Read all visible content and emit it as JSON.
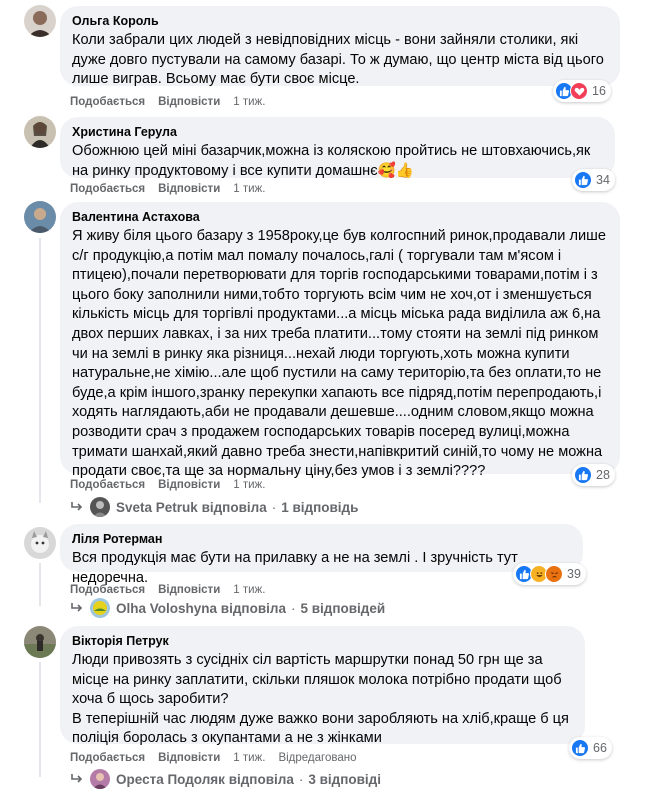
{
  "comments": [
    {
      "author": "Ольга Король",
      "text": "Коли забрали цих людей з невідповідних місць - вони зайняли столики, які дуже довго пустували на самому базарі. То ж думаю, що центр міста від цього лише виграв. Всьому має бути своє місце.",
      "like": "Подобається",
      "reply": "Відповісти",
      "time": "1 тиж.",
      "reaction_count": "16",
      "reactions": [
        "like-icon",
        "love-icon"
      ]
    },
    {
      "author": "Христина Герула",
      "text": "Обожнюю цей міні базарчик,можна із коляскою пройтись не штовхаючись,як на ринку продуктовому і все купити домашнє🥰👍",
      "like": "Подобається",
      "reply": "Відповісти",
      "time": "1 тиж.",
      "reaction_count": "34",
      "reactions": [
        "like-icon"
      ]
    },
    {
      "author": "Валентина Астахова",
      "text": "Я живу біля цього базару з 1958року,це був колгоспний ринок,продавали лише с/г продукцію,а потім мал помалу почалось,галі ( торгували там м'ясом і птицею),почали перетворювати для торгів господарськими товарами,потім і з цього боку заполнили ними,тобто торгують всім чим не хоч,от і зменшується кількість місць для торгівлі продуктами...а місць міська рада виділила аж 6,на двох перших лавках, і за них треба платити...тому стояти на землі під ринком чи на землі в ринку яка різниця...нехай люди торгують,хоть можна купити натуральне,не хімію...але щоб пустили на саму територію,та без оплати,то не буде,а крім іншого,зранку перекупки хапають все підряд,потім перепродають,і ходять наглядають,аби не продавали дешевше....одним словом,якщо можна розводити срач з продажем господарських товарів посеред вулиці,можна тримати шанхай,який давно треба знести,напівкритий синій,то чому не можна продати своє,та ще за нормальну ціну,без умов і з землі????",
      "like": "Подобається",
      "reply": "Відповісти",
      "time": "1 тиж.",
      "reaction_count": "28",
      "reactions": [
        "like-icon"
      ],
      "replies_author": "Sveta Petruk",
      "replies_verb": "відповіла",
      "replies_count": "1 відповідь"
    },
    {
      "author": "Ліля Ротерман",
      "text": "Вся продукція має бути на прилавку а не на землі . І зручність тут недоречна.",
      "like": "Подобається",
      "reply": "Відповісти",
      "time": "1 тиж.",
      "reaction_count": "39",
      "reactions": [
        "like-icon",
        "haha-icon",
        "angry-icon"
      ],
      "replies_author": "Olha Voloshyna",
      "replies_verb": "відповіла",
      "replies_count": "5 відповідей"
    },
    {
      "author": "Вікторія Петрук",
      "text": "Люди привозять з сусідніх сіл вартість маршрутки понад 50 грн ще за місце на ринку заплатити, скільки пляшок молока потрібно продати щоб хоча б щось заробити?",
      "text2": "В теперішній час людям дуже важко вони заробляють на хліб,краще б ця поліція боролась з окупантами а не з жінками",
      "like": "Подобається",
      "reply": "Відповісти",
      "time": "1 тиж.",
      "edited": "Відредаговано",
      "reaction_count": "66",
      "reactions": [
        "like-icon"
      ],
      "replies_author": "Ореста Подоляк",
      "replies_verb": "відповіла",
      "replies_count": "3 відповіді"
    }
  ],
  "colors": {
    "bubble": "#f0f2f5",
    "meta_text": "#65676b",
    "like": "#1877f2",
    "love": "#f33e58",
    "haha": "#f7b125",
    "angry": "#e9710f"
  }
}
